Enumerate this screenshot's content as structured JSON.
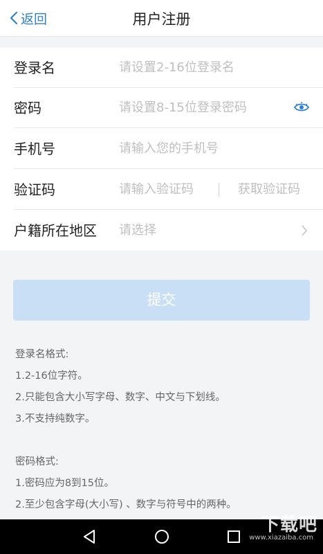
{
  "header": {
    "back_label": "返回",
    "title": "用户注册"
  },
  "form": {
    "rows": [
      {
        "label": "登录名",
        "placeholder": "请设置2-16位登录名"
      },
      {
        "label": "密码",
        "placeholder": "请设置8-15位登录密码",
        "icon": "eye-icon"
      },
      {
        "label": "手机号",
        "placeholder": "请输入您的手机号"
      },
      {
        "label": "验证码",
        "placeholder": "请输入验证码",
        "action": "获取验证码"
      },
      {
        "label": "户籍所在地区",
        "value": "请选择",
        "icon": "chevron-right-icon"
      }
    ]
  },
  "submit_label": "提交",
  "rules": {
    "username_title": "登录名格式:",
    "username_rules": [
      "1.2-16位字符。",
      "2.只能包含大小写字母、数字、中文与下划线。",
      "3.不支持纯数字。"
    ],
    "password_title": "密码格式:",
    "password_rules": [
      "1.密码应为8到15位。",
      "2.至少包含字母(大小写) 、数字与符号中的两种。"
    ]
  },
  "navbar": {
    "icons": [
      "back-triangle-icon",
      "home-circle-icon",
      "recents-square-icon"
    ]
  },
  "watermark": {
    "text": "下载吧",
    "url": "www.xiazaiba.com"
  },
  "colors": {
    "accent": "#2f7fd0",
    "submit_disabled": "#c8dff6",
    "placeholder": "#bfbfbf",
    "background": "#f3f4f6"
  }
}
